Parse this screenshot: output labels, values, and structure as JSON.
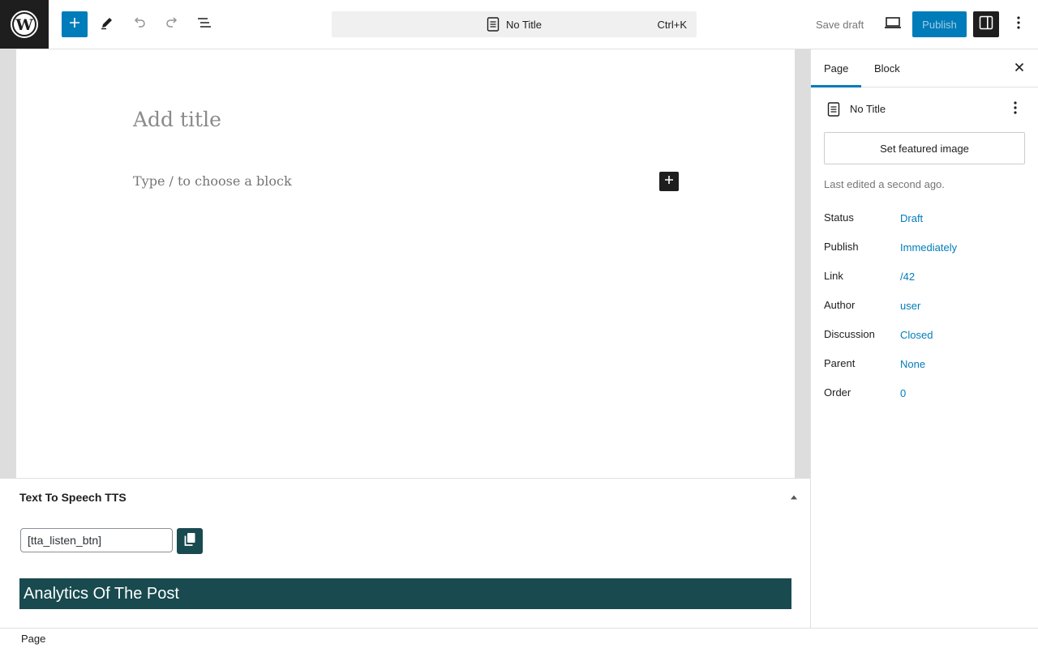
{
  "toolbar": {
    "command_bar_title": "No Title",
    "command_bar_shortcut": "Ctrl+K",
    "save_draft_label": "Save draft",
    "publish_label": "Publish",
    "accent_color": "#007cba",
    "icons": [
      "wordpress-logo-icon",
      "plus-icon",
      "pencil-icon",
      "undo-icon",
      "redo-icon",
      "document-overview-icon",
      "page-icon",
      "desktop-preview-icon",
      "sidebar-settings-icon",
      "more-vertical-icon"
    ]
  },
  "editor": {
    "title_placeholder": "Add title",
    "block_placeholder": "Type / to choose a block"
  },
  "meta_boxes": {
    "tts_title": "Text To Speech TTS",
    "shortcode_value": "[tta_listen_btn]",
    "analytics_heading": "Analytics Of The Post",
    "panel_color": "#184a4f"
  },
  "sidebar": {
    "tabs": [
      {
        "label": "Page",
        "active": true
      },
      {
        "label": "Block",
        "active": false
      }
    ],
    "document_title": "No Title",
    "featured_image_label": "Set featured image",
    "last_edited": "Last edited a second ago.",
    "rows": [
      {
        "label": "Status",
        "value": "Draft"
      },
      {
        "label": "Publish",
        "value": "Immediately"
      },
      {
        "label": "Link",
        "value": "/42"
      },
      {
        "label": "Author",
        "value": "user"
      },
      {
        "label": "Discussion",
        "value": "Closed"
      },
      {
        "label": "Parent",
        "value": "None"
      },
      {
        "label": "Order",
        "value": "0"
      }
    ]
  },
  "footer": {
    "breadcrumb": "Page"
  }
}
